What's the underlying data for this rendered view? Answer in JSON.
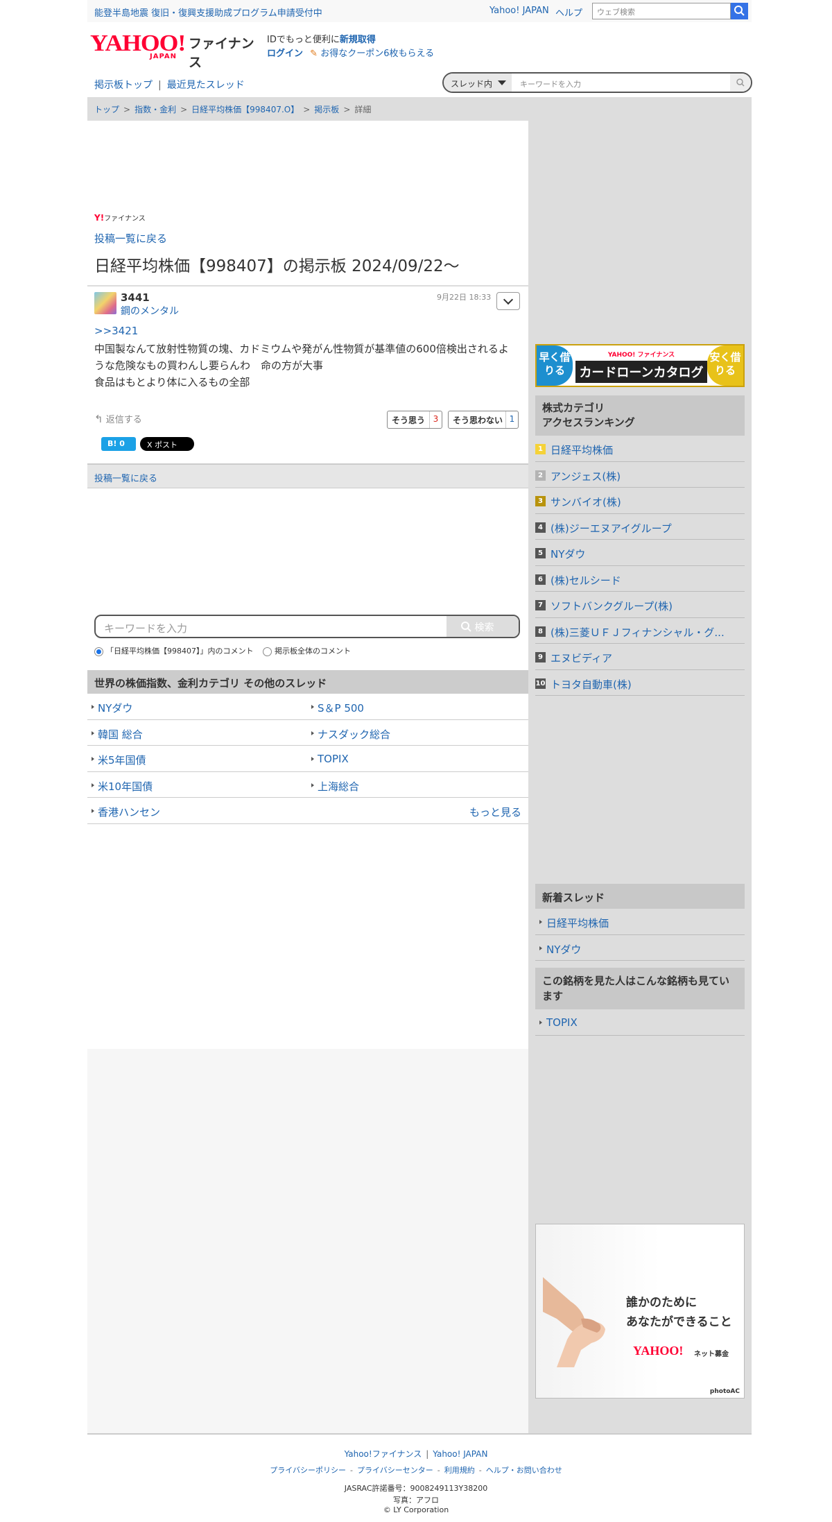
{
  "topbar": {
    "notice": "能登半島地震 復旧・復興支援助成プログラム申請受付中",
    "yahoo_japan": "Yahoo! JAPAN",
    "help": "ヘルプ",
    "websearch_placeholder": "ウェブ検索"
  },
  "header": {
    "logo_yahoo": "YAHOO!",
    "logo_japan": "JAPAN",
    "logo_finance": "ファイナンス",
    "id_note_prefix": "IDでもっと便利に",
    "id_note_link": "新規取得",
    "login": "ログイン",
    "coupon": "お得なクーポン6枚もらえる"
  },
  "subnav": {
    "board_top": "掲示板トップ",
    "separator": "|",
    "recent": "最近見たスレッド"
  },
  "thread_search": {
    "scope": "スレッド内",
    "placeholder": "キーワードを入力"
  },
  "breadcrumb": {
    "items": [
      "トップ",
      "指数・金利",
      "日経平均株価【998407.O】",
      "掲示板",
      "詳細"
    ],
    "gt": ">"
  },
  "board": {
    "finance_mini_y": "Y!",
    "finance_mini_label": "ファイナンス",
    "back_to_list": "投稿一覧に戻る",
    "title": "日経平均株価【998407】の掲示板 2024/09/22〜"
  },
  "post": {
    "number": "3441",
    "author": "鋼のメンタル",
    "time": "9月22日 18:33",
    "anchor": ">>3421",
    "body": "中国製なんて放射性物質の塊、カドミウムや発がん性物質が基準値の600倍検出されるような危険なもの買わんし要らんわ　命の方が大事\n食品はもとより体に入るもの全部",
    "reply": "返信する",
    "agree_label": "そう思う",
    "agree_count": "3",
    "disagree_label": "そう思わない",
    "disagree_count": "1",
    "hatena": "B! 0",
    "xpost": "X ポスト"
  },
  "back_bar": "投稿一覧に戻る",
  "keyword_search": {
    "placeholder": "キーワードを入力",
    "button": "検索",
    "option_thread": "「日経平均株価【998407】」内のコメント",
    "option_all": "掲示板全体のコメント"
  },
  "other_threads": {
    "heading": "世界の株価指数、金利カテゴリ  その他のスレッド",
    "rows": [
      [
        "NYダウ",
        "S＆P 500"
      ],
      [
        "韓国 総合",
        "ナスダック総合"
      ],
      [
        "米5年国債",
        "TOPIX"
      ],
      [
        "米10年国債",
        "上海総合"
      ]
    ],
    "last": "香港ハンセン",
    "more": "もっと見る"
  },
  "side": {
    "ad": {
      "left": "早く借りる",
      "brand": "YAHOO! ファイナンス",
      "title": "カードローンカタログ",
      "right": "安く借りる"
    },
    "ranking_heading_1": "株式カテゴリ",
    "ranking_heading_2": "アクセスランキング",
    "ranking": [
      {
        "rank": "1",
        "name": "日経平均株価"
      },
      {
        "rank": "2",
        "name": "アンジェス(株)"
      },
      {
        "rank": "3",
        "name": "サンバイオ(株)"
      },
      {
        "rank": "4",
        "name": "(株)ジーエヌアイグループ"
      },
      {
        "rank": "5",
        "name": "NYダウ"
      },
      {
        "rank": "6",
        "name": "(株)セルシード"
      },
      {
        "rank": "7",
        "name": "ソフトバンクグループ(株)"
      },
      {
        "rank": "8",
        "name": "(株)三菱ＵＦＪフィナンシャル・グ..."
      },
      {
        "rank": "9",
        "name": "エヌビディア"
      },
      {
        "rank": "10",
        "name": "トヨタ自動車(株)"
      }
    ],
    "new_threads_heading": "新着スレッド",
    "new_threads": [
      "日経平均株価",
      "NYダウ"
    ],
    "also_viewed_heading": "この銘柄を見た人はこんな銘柄も見ています",
    "also_viewed": [
      "TOPIX"
    ],
    "charity": {
      "line1": "誰かのために",
      "line2": "あなたができること",
      "logo": "YAHOO!",
      "logo_sub": "ネット募金",
      "photo": "photoAC"
    }
  },
  "footer": {
    "line1": [
      "Yahoo!ファイナンス",
      "Yahoo! JAPAN"
    ],
    "line1_sep": "|",
    "line2": [
      "プライバシーポリシー",
      "プライバシーセンター",
      "利用規約",
      "ヘルプ・お問い合わせ"
    ],
    "line2_sep": "-",
    "jasrac": "JASRAC許諾番号：9008249113Y38200",
    "photo": "写真：アフロ",
    "copyright": "© LY Corporation"
  },
  "colors": {
    "link": "#1f65b0",
    "brand_red": "#ff0033",
    "search_blue": "#3472e6",
    "agree_red": "#d9261c"
  }
}
